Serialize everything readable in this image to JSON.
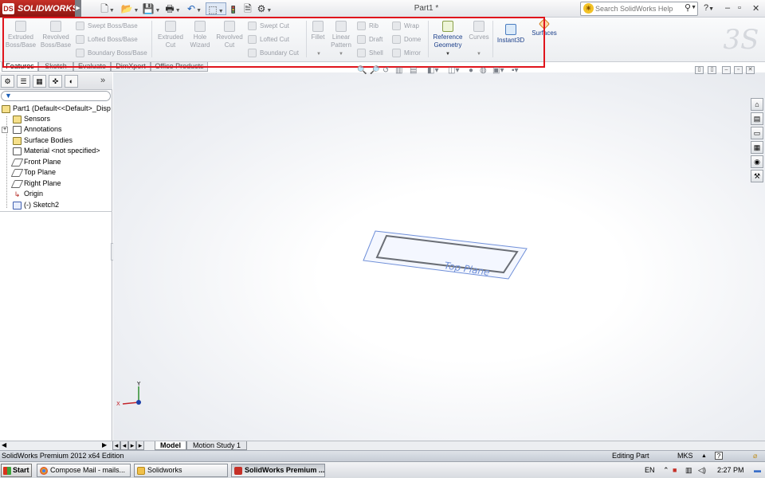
{
  "app": {
    "logo_text": "SOLIDWORKS",
    "logo_badge": "DS",
    "doc_title": "Part1 *"
  },
  "quick_access": {
    "new": "🗋",
    "open": "📂",
    "save": "💾",
    "print": "🖶",
    "undo": "↶",
    "select": "⬚",
    "rebuild": "🚦",
    "options": "⚙"
  },
  "search": {
    "placeholder": "Search SolidWorks Help",
    "help": "?"
  },
  "window_controls": {
    "minimize": "–",
    "restore": "▫",
    "close": "✕"
  },
  "commands": {
    "extruded_boss": "Extruded Boss/Base",
    "revolved_boss": "Revolved Boss/Base",
    "swept_boss": "Swept Boss/Base",
    "lofted_boss": "Lofted Boss/Base",
    "boundary_boss": "Boundary Boss/Base",
    "extruded_cut": "Extruded Cut",
    "hole_wizard": "Hole Wizard",
    "revolved_cut": "Revolved Cut",
    "swept_cut": "Swept Cut",
    "lofted_cut": "Lofted Cut",
    "boundary_cut": "Boundary Cut",
    "fillet": "Fillet",
    "linear_pattern": "Linear Pattern",
    "rib": "Rib",
    "draft": "Draft",
    "shell": "Shell",
    "wrap": "Wrap",
    "dome": "Dome",
    "mirror": "Mirror",
    "reference_geometry": "Reference Geometry",
    "curves": "Curves",
    "instant3d": "Instant3D",
    "surfaces": "Surfaces"
  },
  "tabs": [
    "Features",
    "Sketch",
    "Evaluate",
    "DimXpert",
    "Office Products"
  ],
  "feature_tree": {
    "root": "Part1  (Default<<Default>_Disp",
    "items": [
      "Sensors",
      "Annotations",
      "Surface Bodies",
      "Material <not specified>",
      "Front Plane",
      "Top Plane",
      "Right Plane",
      "Origin",
      "(-) Sketch2"
    ]
  },
  "viewport": {
    "plane_label": "Top Plane",
    "triad_x": "X",
    "triad_y": "Y"
  },
  "model_tabs": [
    "Model",
    "Motion Study 1"
  ],
  "status": {
    "edition": "SolidWorks Premium 2012 x64 Edition",
    "mode": "Editing Part",
    "units": "MKS",
    "help": "?"
  },
  "taskbar": {
    "start": "Start",
    "tasks": [
      "Compose Mail - mails...",
      "Solidworks",
      "SolidWorks Premium ..."
    ],
    "lang": "EN",
    "time": "2:27 PM"
  },
  "colors": {
    "highlight_box": "#e0141c",
    "brand_red": "#b01e18",
    "sketch_blue": "#6f8fd8"
  }
}
